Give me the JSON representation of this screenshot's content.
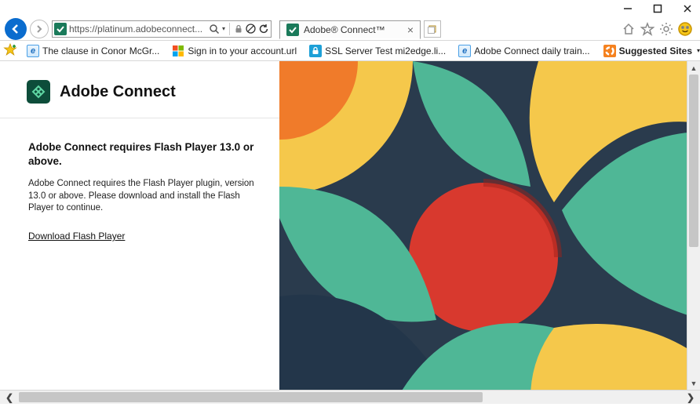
{
  "window": {
    "url_display": "https://platinum.adobeconnect...",
    "tab_title": "Adobe® Connect™"
  },
  "bookmarks": [
    {
      "label": "The clause in Conor McGr...",
      "icon": "ie"
    },
    {
      "label": "Sign in to your account.url",
      "icon": "ms"
    },
    {
      "label": "SSL Server Test mi2edge.li...",
      "icon": "lock"
    },
    {
      "label": "Adobe Connect daily train...",
      "icon": "ie"
    }
  ],
  "suggested_sites_label": "Suggested Sites",
  "page": {
    "brand": "Adobe Connect",
    "heading": "Adobe Connect requires Flash Player 13.0 or above.",
    "body": "Adobe Connect requires the Flash Player plugin, version 13.0 or above. Please download and install the Flash Player to continue.",
    "link": "Download Flash Player"
  }
}
